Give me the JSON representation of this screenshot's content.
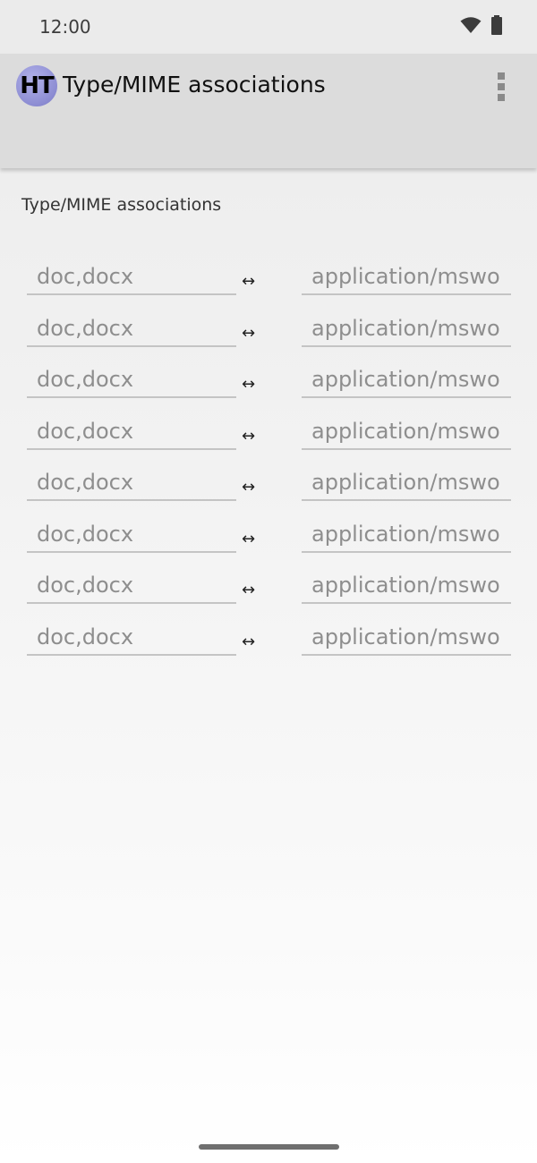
{
  "status_bar": {
    "time": "12:00",
    "icons": [
      "wifi-icon",
      "battery-icon"
    ]
  },
  "app_bar": {
    "logo_text": "HT",
    "title": "Type/MIME associations",
    "menu_icon": "overflow-menu-icon"
  },
  "content": {
    "heading": "Type/MIME associations",
    "separator": "↔",
    "associations": [
      {
        "extensions_placeholder": "doc,docx",
        "mime_placeholder": "application/mswo"
      },
      {
        "extensions_placeholder": "doc,docx",
        "mime_placeholder": "application/mswo"
      },
      {
        "extensions_placeholder": "doc,docx",
        "mime_placeholder": "application/mswo"
      },
      {
        "extensions_placeholder": "doc,docx",
        "mime_placeholder": "application/mswo"
      },
      {
        "extensions_placeholder": "doc,docx",
        "mime_placeholder": "application/mswo"
      },
      {
        "extensions_placeholder": "doc,docx",
        "mime_placeholder": "application/mswo"
      },
      {
        "extensions_placeholder": "doc,docx",
        "mime_placeholder": "application/mswo"
      },
      {
        "extensions_placeholder": "doc,docx",
        "mime_placeholder": "application/mswo"
      }
    ]
  },
  "colors": {
    "app_bar": "#dcdcdc",
    "logo": "#8c8cd2",
    "placeholder_text": "#8e8e8e",
    "underline": "#c4c4c4"
  }
}
